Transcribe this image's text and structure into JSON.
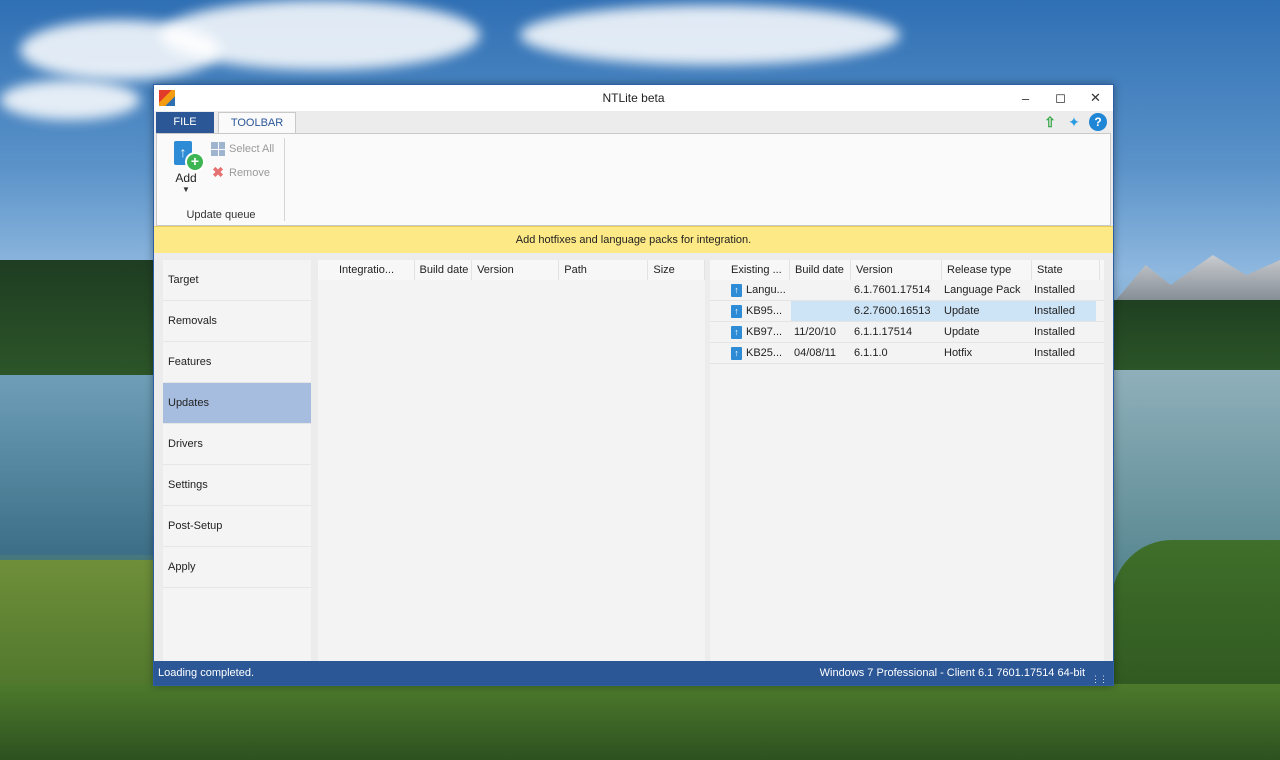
{
  "window": {
    "title": "NTLite beta"
  },
  "tabs": {
    "file": "FILE",
    "toolbar": "TOOLBAR"
  },
  "ribbon": {
    "add_label": "Add",
    "select_all_label": "Select All",
    "remove_label": "Remove",
    "group_label": "Update queue"
  },
  "banner": {
    "text": "Add hotfixes and language packs for integration."
  },
  "sidebar": {
    "items": [
      {
        "label": "Target"
      },
      {
        "label": "Removals"
      },
      {
        "label": "Features"
      },
      {
        "label": "Updates",
        "active": true
      },
      {
        "label": "Drivers"
      },
      {
        "label": "Settings"
      },
      {
        "label": "Post-Setup"
      },
      {
        "label": "Apply"
      }
    ]
  },
  "queue_table": {
    "columns": [
      "Integratio...",
      "Build date",
      "Version",
      "Path",
      "Size"
    ]
  },
  "existing_table": {
    "columns": [
      "Existing ...",
      "Build date",
      "Version",
      "Release type",
      "State"
    ],
    "rows": [
      {
        "name": "Langu...",
        "build_date": "",
        "version": "6.1.7601.17514",
        "release_type": "Language Pack",
        "state": "Installed"
      },
      {
        "name": "KB95...",
        "build_date": "",
        "version": "6.2.7600.16513",
        "release_type": "Update",
        "state": "Installed",
        "selected": true
      },
      {
        "name": "KB97...",
        "build_date": "11/20/10",
        "version": "6.1.1.17514",
        "release_type": "Update",
        "state": "Installed"
      },
      {
        "name": "KB25...",
        "build_date": "04/08/11",
        "version": "6.1.1.0",
        "release_type": "Hotfix",
        "state": "Installed"
      }
    ]
  },
  "status": {
    "left": "Loading completed.",
    "right": "Windows 7 Professional - Client 6.1 7601.17514 64-bit"
  },
  "icons": [
    "app-icon",
    "minimize-icon",
    "maximize-icon",
    "close-icon",
    "update-arrow-icon",
    "twitter-icon",
    "help-icon",
    "add-update-icon",
    "select-all-icon",
    "remove-icon",
    "update-package-icon"
  ],
  "colors": {
    "accent": "#2b5797",
    "banner": "#fde985",
    "selected_nav": "#a7bde0"
  }
}
